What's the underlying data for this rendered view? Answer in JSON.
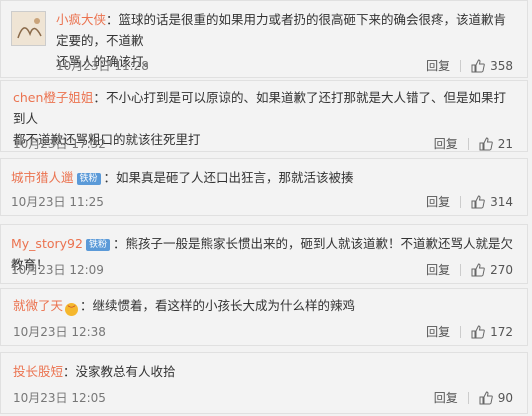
{
  "comments": [
    {
      "user": "小疯大侠",
      "text": "篮球的话是很重的如果用力或者扔的很高砸下来的确会很疼，该道歉肯定要的，不道歉",
      "text2": "还骂人的确该打。",
      "date": "10月23日 11:28",
      "reply": "回复",
      "likes": "358"
    },
    {
      "user": "chen橙子姐姐",
      "text": "不小心打到是可以原谅的、如果道歉了还打那就是大人错了、但是如果打到人",
      "text2": "都不道歉还骂粗口的就该往死里打",
      "date": "10月23日 17:32",
      "reply": "回复",
      "likes": "21"
    },
    {
      "user": "城市猎人邋",
      "badge": "铁粉",
      "text": "如果真是砸了人还口出狂言，那就活该被揍",
      "date": "10月23日 11:25",
      "reply": "回复",
      "likes": "314"
    },
    {
      "user": "My_story92",
      "badge": "铁粉",
      "text": "熊孩子一般是熊家长惯出来的，砸到人就该道歉！不道歉还骂人就是欠教育！",
      "date": "10月23日 12:09",
      "reply": "回复",
      "likes": "270"
    },
    {
      "user": "就微了天",
      "emoji": "🙁",
      "text": "继续惯着，看这样的小孩长大成为什么样的辣鸡",
      "date": "10月23日 12:38",
      "reply": "回复",
      "likes": "172"
    },
    {
      "user": "投长股短",
      "text": "没家教总有人收拾",
      "date": "10月23日 12:05",
      "reply": "回复",
      "likes": "90"
    }
  ]
}
